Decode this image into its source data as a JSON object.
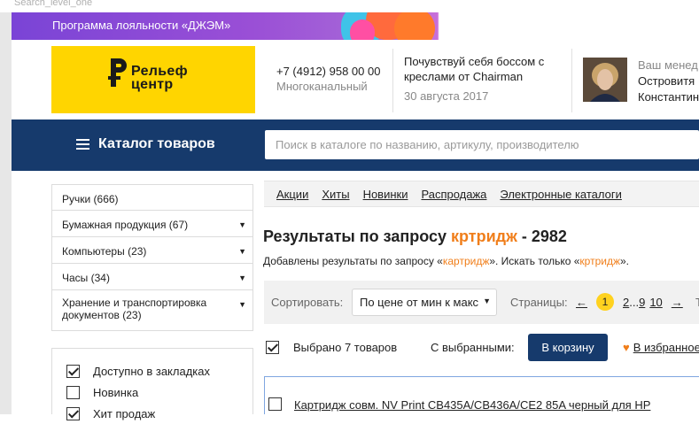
{
  "window": {
    "caption": "Search_level_one"
  },
  "promo": {
    "text": "Программа лояльности «ДЖЭМ»"
  },
  "header": {
    "logo_line1": "Рельеф",
    "logo_line2": "центр",
    "phone": "+7 (4912) 958 00 00",
    "phone_sub": "Многоканальный",
    "news_title": "Почувствуй себя боссом с креслами от Chairman",
    "news_date": "30 августа 2017",
    "manager_title": "Ваш менед",
    "manager_name1": "Островитя",
    "manager_name2": "Константин"
  },
  "nav": {
    "catalog_label": "Каталог товаров",
    "search_placeholder": "Поиск в каталоге по названию, артикулу, производителю"
  },
  "sidebar": {
    "categories": [
      {
        "label": "Ручки (666)",
        "expandable": false
      },
      {
        "label": "Бумажная продукция (67)",
        "expandable": true
      },
      {
        "label": "Компьютеры (23)",
        "expandable": true
      },
      {
        "label": "Часы (34)",
        "expandable": true
      },
      {
        "label": "Хранение и транспортировка документов (23)",
        "expandable": true
      }
    ],
    "filters": [
      {
        "label": "Доступно в закладках",
        "checked": true
      },
      {
        "label": "Новинка",
        "checked": false
      },
      {
        "label": "Хит продаж",
        "checked": true
      }
    ]
  },
  "tabs": [
    "Акции",
    "Хиты",
    "Новинки",
    "Распродажа",
    "Электронные каталоги"
  ],
  "results": {
    "title_prefix": "Результаты по запросу",
    "query": "кртридж",
    "count_suffix": " - 2982",
    "added_prefix": "Добавлены результаты по запросу «",
    "added_query": "картридж",
    "added_mid": "». Искать только «",
    "added_query2": "кртридж",
    "added_end": "»."
  },
  "sort": {
    "label": "Сортировать:",
    "selected": "По цене от мин к макс",
    "pages_label": "Страницы:",
    "prev_arrow": "←",
    "current_page": "1",
    "page2": "2",
    "ellipsis": "...",
    "page9": "9",
    "page10": "10",
    "next_arrow": "→",
    "trailing": "То"
  },
  "selection": {
    "checked": true,
    "count_text": "Выбрано 7 товаров",
    "with_selected": "С выбранными:",
    "cart_button": "В корзину",
    "favorites": "В избранное"
  },
  "products": [
    {
      "title": "Картридж совм. NV Print  CB435A/CB436A/CE2 85A черный для HP",
      "checked": false
    }
  ],
  "colors": {
    "navy": "#163a6c",
    "accent": "#f07e1a",
    "logo_yellow": "#ffd500"
  }
}
